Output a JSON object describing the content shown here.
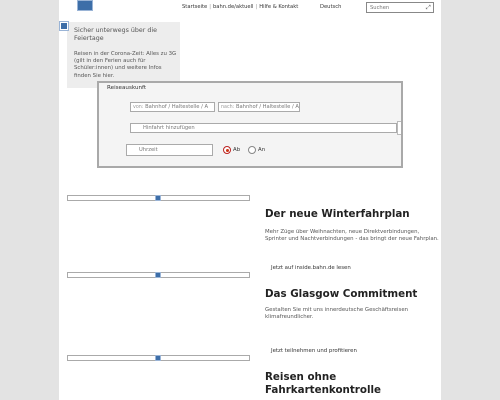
{
  "header": {
    "nav": [
      "Startseite",
      "bahn.de/aktuell",
      "Hilfe & Kontakt"
    ],
    "language": "Deutsch",
    "search_placeholder": "Suchen"
  },
  "notice": {
    "title": "Sicher unterwegs über die Feiertage",
    "body": "Reisen in der Corona-Zeit: Alles zu 3G (gilt in den Ferien auch für Schüler:innen) und weitere Infos finden Sie hier."
  },
  "reiseauskunft": {
    "title": "Reiseauskunft",
    "from_prefix": "von:",
    "from_placeholder": "Bahnhof / Haltestelle / A",
    "to_prefix": "nach:",
    "to_placeholder": "Bahnhof / Haltestelle / A",
    "via_placeholder": "Hinfahrt hinzufügen",
    "time_placeholder": "Uhrzeit",
    "options": [
      {
        "label": "Ab",
        "selected": true
      },
      {
        "label": "An",
        "selected": false
      }
    ]
  },
  "articles": [
    {
      "title": "Der neue Winterfahrplan",
      "body": "Mehr Züge über Weihnachten, neue Direktverbindungen, Sprinter und Nachtverbindungen - das bringt der neue Fahrplan.",
      "link": "Jetzt auf inside.bahn.de lesen"
    },
    {
      "title": "Das Glasgow Commitment",
      "body": "Gestalten Sie mit uns innerdeutsche Geschäftsreisen klimafreundlicher.",
      "link": "Jetzt teilnehmen und profitieren"
    },
    {
      "title": "Reisen ohne Fahrkartenkontrolle",
      "body": "",
      "link": ""
    }
  ]
}
